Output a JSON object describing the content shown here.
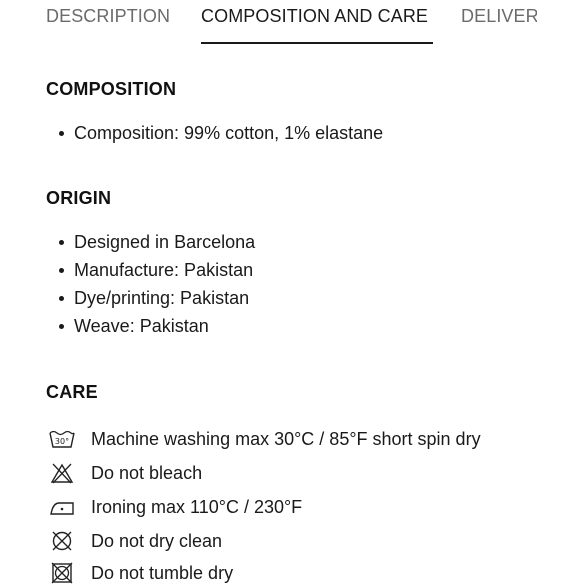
{
  "tabs": [
    {
      "label": "DESCRIPTION",
      "active": false
    },
    {
      "label": "COMPOSITION AND CARE",
      "active": true
    },
    {
      "label": "DELIVERY",
      "active": false
    }
  ],
  "composition": {
    "heading": "COMPOSITION",
    "items": [
      "Composition: 99% cotton, 1% elastane"
    ]
  },
  "origin": {
    "heading": "ORIGIN",
    "items": [
      "Designed in Barcelona",
      "Manufacture: Pakistan",
      "Dye/printing: Pakistan",
      "Weave: Pakistan"
    ]
  },
  "care": {
    "heading": "CARE",
    "items": [
      {
        "icon": "wash-30-icon",
        "label": "Machine washing max 30°C / 85°F short spin dry",
        "icon_text": "30°"
      },
      {
        "icon": "no-bleach-icon",
        "label": "Do not bleach"
      },
      {
        "icon": "iron-one-dot-icon",
        "label": "Ironing max 110°C / 230°F"
      },
      {
        "icon": "no-dry-clean-icon",
        "label": "Do not dry clean"
      },
      {
        "icon": "no-tumble-dry-icon",
        "label": "Do not tumble dry"
      }
    ]
  },
  "colors": {
    "text": "#111111",
    "muted": "#6b6b6b",
    "underline": "#1a1a1a"
  }
}
